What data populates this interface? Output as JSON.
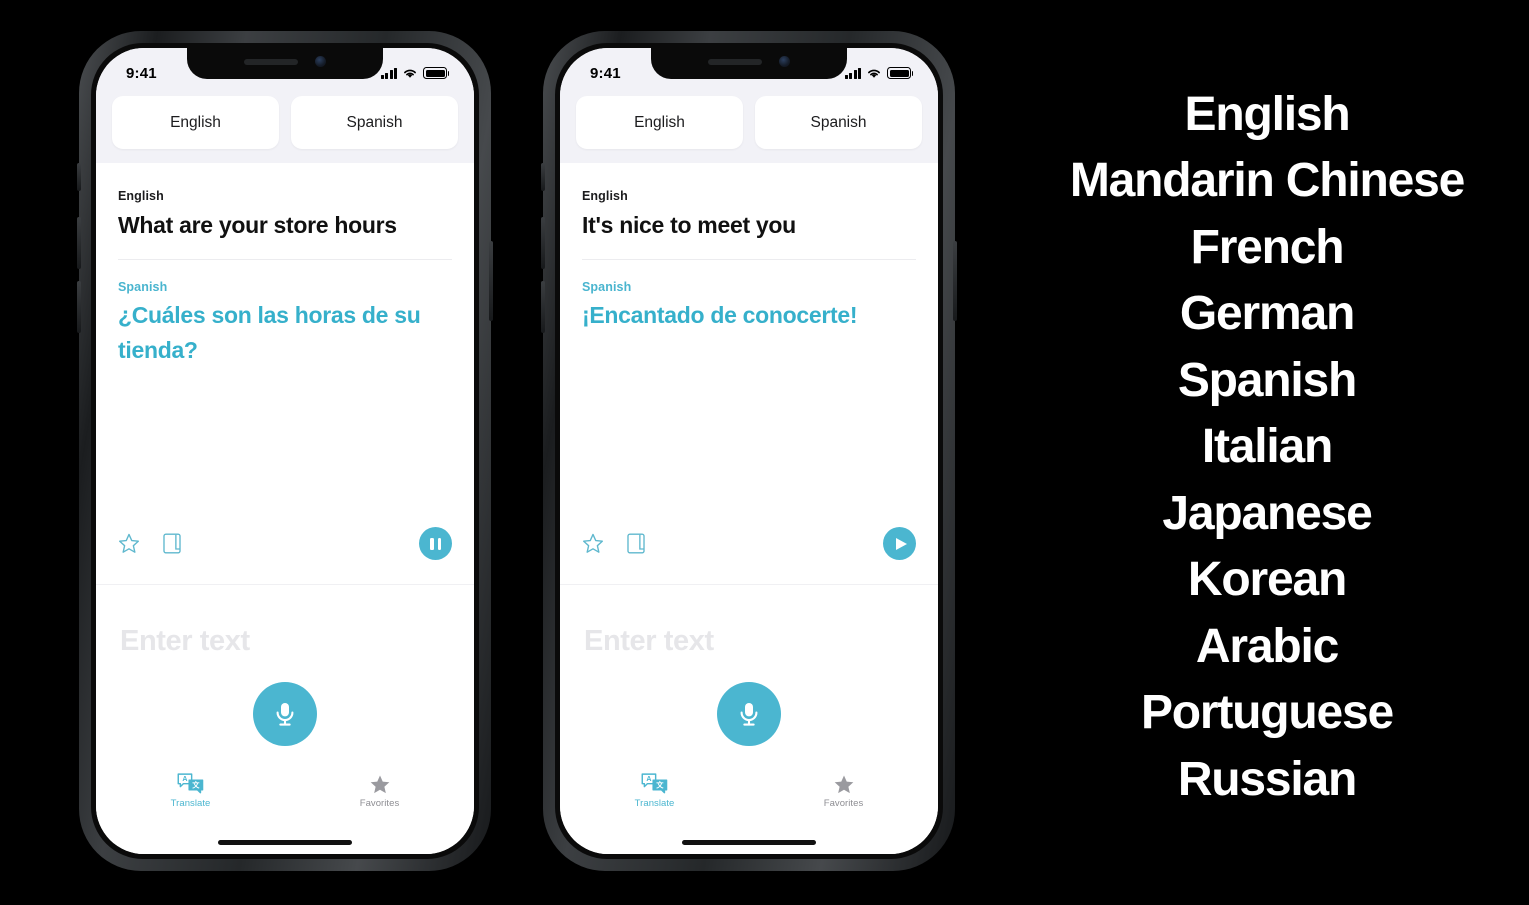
{
  "background_color": "#000000",
  "accent_color": "#4bb6d0",
  "phones": [
    {
      "id": "phone-1",
      "status_bar": {
        "time": "9:41",
        "signal_icon": "cellular-bars-icon",
        "wifi_icon": "wifi-icon",
        "battery_icon": "battery-icon"
      },
      "language_selector": {
        "source_label": "English",
        "target_label": "Spanish"
      },
      "translation_card": {
        "source_language_label": "English",
        "source_text": "What are your store hours",
        "target_language_label": "Spanish",
        "target_text": "¿Cuáles son las horas de su tienda?",
        "favorite_icon": "star-outline-icon",
        "dictionary_icon": "book-outline-icon",
        "media_button_state": "pause",
        "media_button_icon": "pause-icon"
      },
      "input_area": {
        "placeholder": "Enter text",
        "mic_icon": "microphone-icon"
      },
      "tab_bar": {
        "tabs": [
          {
            "label": "Translate",
            "icon": "translate-bubbles-icon",
            "active": true
          },
          {
            "label": "Favorites",
            "icon": "star-filled-icon",
            "active": false
          }
        ]
      }
    },
    {
      "id": "phone-2",
      "status_bar": {
        "time": "9:41",
        "signal_icon": "cellular-bars-icon",
        "wifi_icon": "wifi-icon",
        "battery_icon": "battery-icon"
      },
      "language_selector": {
        "source_label": "English",
        "target_label": "Spanish"
      },
      "translation_card": {
        "source_language_label": "English",
        "source_text": "It's nice to meet you",
        "target_language_label": "Spanish",
        "target_text": "¡Encantado de conocerte!",
        "favorite_icon": "star-outline-icon",
        "dictionary_icon": "book-outline-icon",
        "media_button_state": "play",
        "media_button_icon": "play-icon"
      },
      "input_area": {
        "placeholder": "Enter text",
        "mic_icon": "microphone-icon"
      },
      "tab_bar": {
        "tabs": [
          {
            "label": "Translate",
            "icon": "translate-bubbles-icon",
            "active": true
          },
          {
            "label": "Favorites",
            "icon": "star-filled-icon",
            "active": false
          }
        ]
      }
    }
  ],
  "language_list": {
    "items": [
      "English",
      "Mandarin Chinese",
      "French",
      "German",
      "Spanish",
      "Italian",
      "Japanese",
      "Korean",
      "Arabic",
      "Portuguese",
      "Russian"
    ]
  }
}
